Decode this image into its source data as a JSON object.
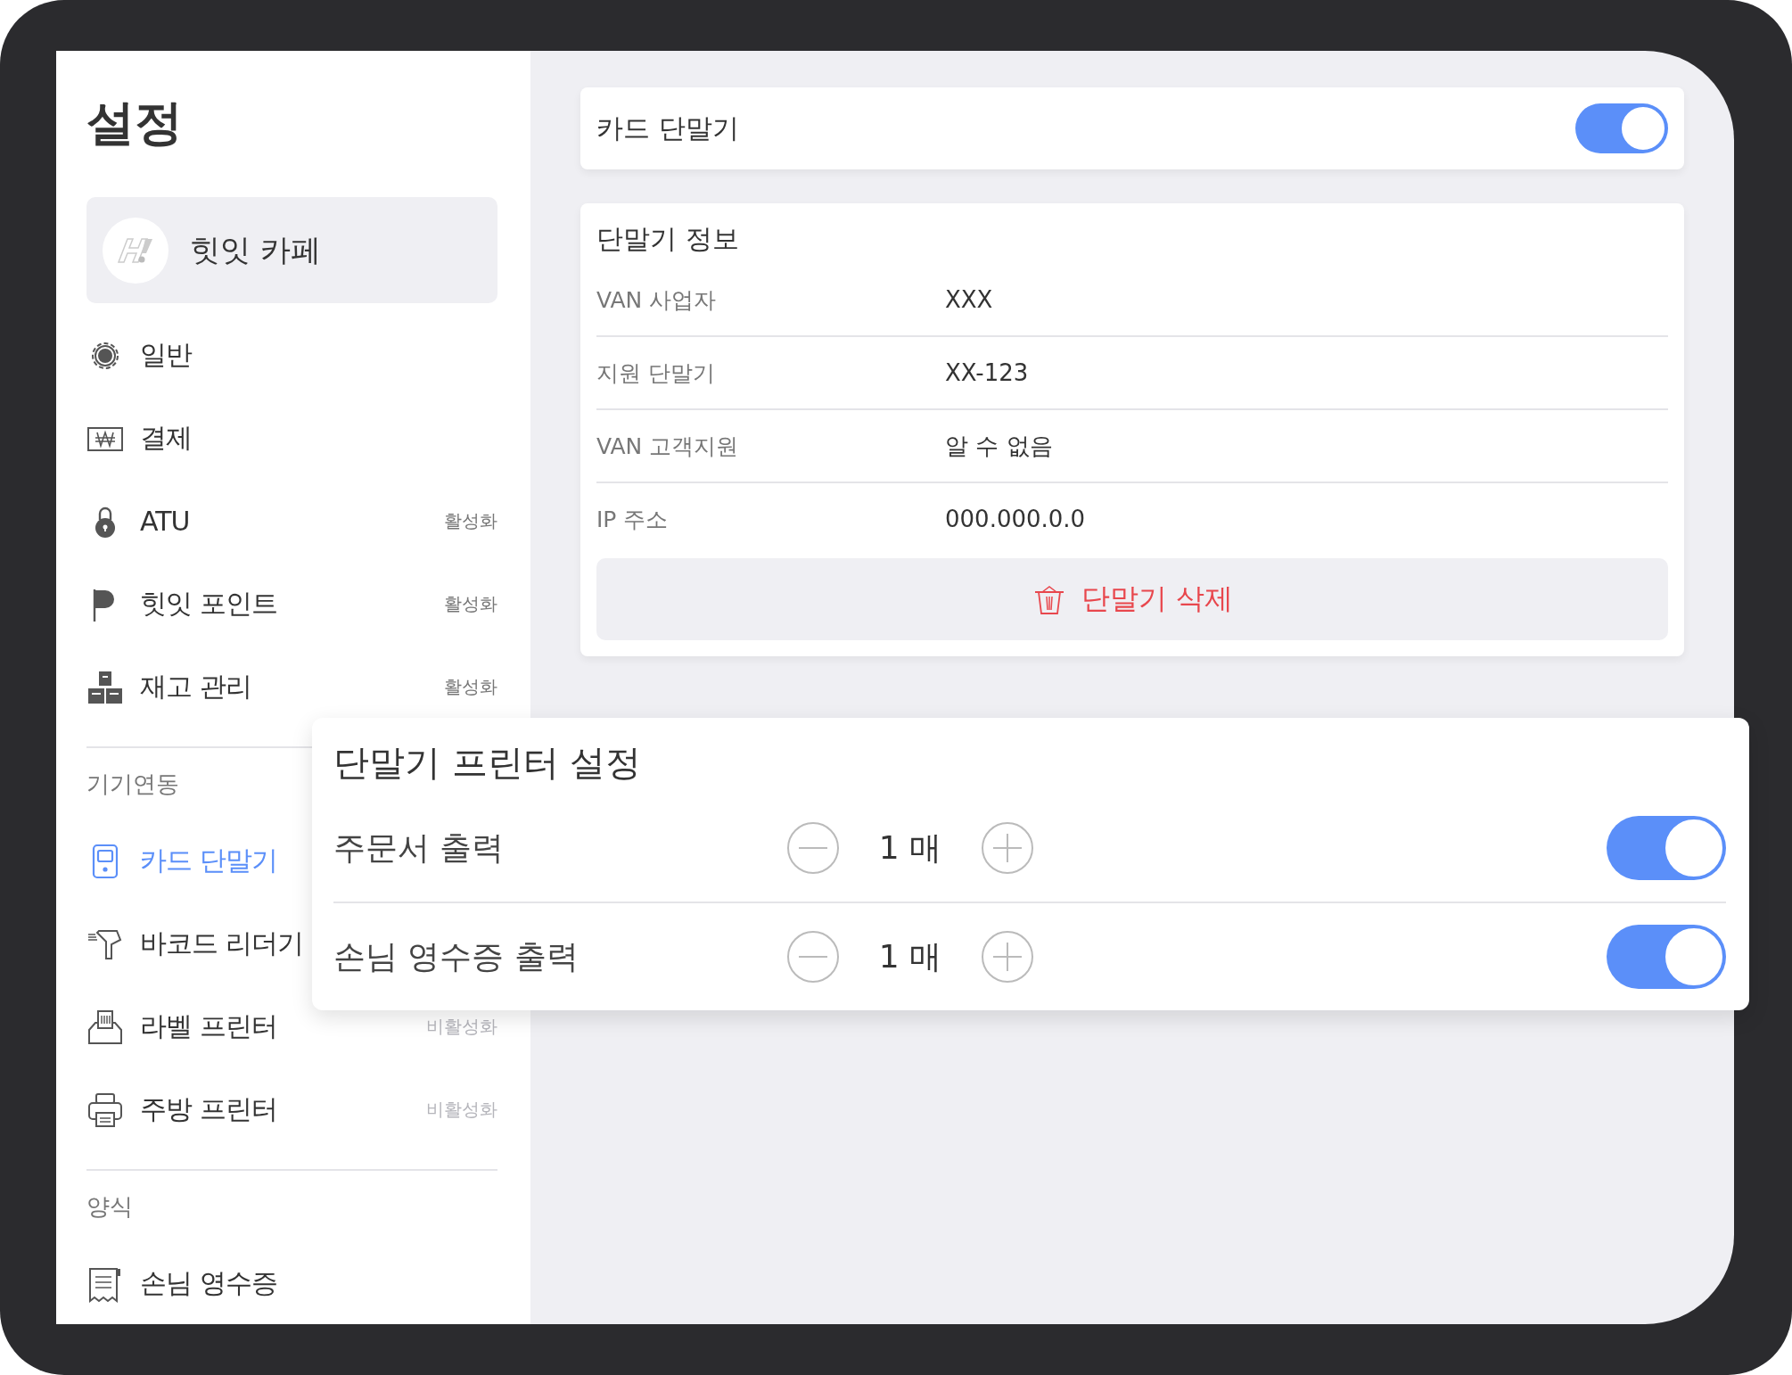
{
  "sidebar": {
    "title": "설정",
    "store": {
      "name": "힛잇 카페"
    },
    "groups": [
      {
        "items": [
          {
            "kind": "general",
            "label": "일반",
            "selected": false
          },
          {
            "kind": "payment",
            "label": "결제",
            "selected": false
          },
          {
            "kind": "atu",
            "label": "ATU",
            "status": "활성화",
            "active": true,
            "selected": false
          },
          {
            "kind": "points",
            "label": "힛잇 포인트",
            "status": "활성화",
            "active": true,
            "selected": false
          },
          {
            "kind": "inventory",
            "label": "재고 관리",
            "status": "활성화",
            "active": true,
            "selected": false
          }
        ]
      },
      {
        "heading": "기기연동",
        "items": [
          {
            "kind": "card-terminal",
            "label": "카드 단말기",
            "selected": true
          },
          {
            "kind": "barcode",
            "label": "바코드 리더기",
            "selected": false
          },
          {
            "kind": "label-printer",
            "label": "라벨 프린터",
            "status": "비활성화",
            "active": false,
            "selected": false
          },
          {
            "kind": "kitchen-printer",
            "label": "주방 프린터",
            "status": "비활성화",
            "active": false,
            "selected": false
          }
        ]
      },
      {
        "heading": "양식",
        "items": [
          {
            "kind": "receipt",
            "label": "손님 영수증",
            "selected": false
          }
        ]
      }
    ]
  },
  "terminal_toggle": {
    "label": "카드 단말기",
    "on": true
  },
  "terminal_info": {
    "title": "단말기 정보",
    "rows": [
      {
        "label": "VAN 사업자",
        "value": "XXX"
      },
      {
        "label": "지원 단말기",
        "value": "XX-123"
      },
      {
        "label": "VAN 고객지원",
        "value": "알 수 없음"
      },
      {
        "label": "IP 주소",
        "value": "000.000.0.0"
      }
    ],
    "delete_button": "단말기 삭제"
  },
  "printer_settings": {
    "title": "단말기 프린터 설정",
    "rows": [
      {
        "label": "주문서 출력",
        "count": "1 매",
        "on": true
      },
      {
        "label": "손님 영수증 출력",
        "count": "1 매",
        "on": true
      }
    ]
  }
}
